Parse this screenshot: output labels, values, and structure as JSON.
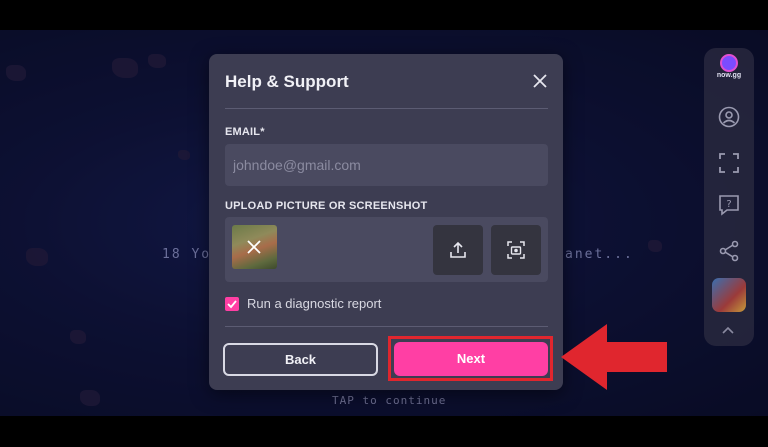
{
  "background": {
    "story_text": "18 Yo",
    "story_text_tail": "anet...",
    "tap_text": "TAP to continue"
  },
  "sidebar": {
    "logo_text": "now.gg",
    "icons": [
      "user-icon",
      "fullscreen-icon",
      "help-icon",
      "share-icon",
      "game-thumbnail",
      "chevron-up-icon"
    ]
  },
  "modal": {
    "title": "Help & Support",
    "email_label": "EMAIL*",
    "email_placeholder": "johndoe@gmail.com",
    "upload_label": "UPLOAD PICTURE OR SCREENSHOT",
    "diagnostic_label": "Run a diagnostic report",
    "diagnostic_checked": true,
    "back_label": "Back",
    "next_label": "Next"
  },
  "colors": {
    "accent_pink": "#ff3fa4",
    "highlight_red": "#e0262e",
    "modal_bg": "#3d3d52"
  }
}
